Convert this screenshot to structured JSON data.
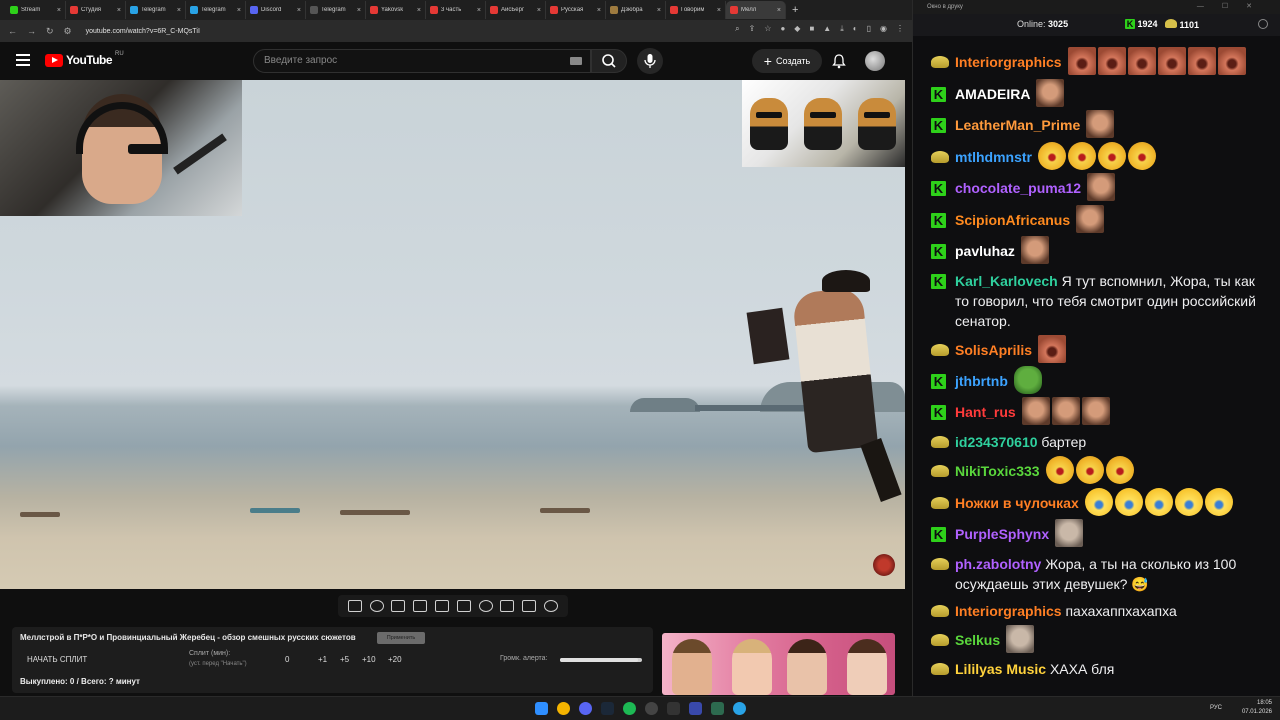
{
  "browser": {
    "tabs": [
      {
        "title": "Stream",
        "color": "#2ed11a"
      },
      {
        "title": "Студия",
        "color": "#e53935"
      },
      {
        "title": "Telegram",
        "color": "#29a3e6"
      },
      {
        "title": "Telegram",
        "color": "#29a3e6"
      },
      {
        "title": "Discord",
        "color": "#5865f2"
      },
      {
        "title": "Telegram",
        "color": "#555555"
      },
      {
        "title": "Yakovsk",
        "color": "#e53935"
      },
      {
        "title": "3 часть",
        "color": "#e53935"
      },
      {
        "title": "АйсБерг",
        "color": "#e53935"
      },
      {
        "title": "Русская",
        "color": "#e53935"
      },
      {
        "title": "Дзюбра",
        "color": "#9e7b3f"
      },
      {
        "title": "Говорим",
        "color": "#e53935"
      },
      {
        "title": "Мелл",
        "color": "#e53935",
        "active": true
      }
    ],
    "url": "youtube.com/watch?v=6R_C-MQsTiI"
  },
  "youtube": {
    "logo_text": "YouTube",
    "region": "RU",
    "search_placeholder": "Введите запрос",
    "create_label": "Создать"
  },
  "panel": {
    "video_title": "Меллстрой в П*Р*О и Провинциальный Жеребец - обзор смешных русских сюжетов",
    "apply_label": "Применить",
    "start_split": "НАЧАТЬ СПЛИТ",
    "split_label": "Сплит (мин):",
    "split_hint": "(уст. перед \"Начать\")",
    "increments": [
      "0",
      "+1",
      "+5",
      "+10",
      "+20"
    ],
    "alert_label": "Громк. алерта:",
    "alert_volume": 0.95,
    "bought": "Выкуплено: 0 / Всего: ? минут"
  },
  "chat": {
    "window_title": "Окно в друку",
    "online_label": "Online:",
    "online_count": "3025",
    "k_count": "1924",
    "gold_count": "1101",
    "messages": [
      {
        "badge": "g",
        "nick": "Interiorgraphics",
        "color": "#ff7f24",
        "emotes": [
          "scream",
          "scream",
          "scream",
          "scream",
          "scream",
          "scream"
        ]
      },
      {
        "badge": "k",
        "nick": "AMADEIRA",
        "color": "#ffffff",
        "emotes": [
          "face"
        ]
      },
      {
        "badge": "k",
        "nick": "LeatherMan_Prime",
        "color": "#ff9a3c",
        "emotes": [
          "face"
        ]
      },
      {
        "badge": "g",
        "nick": "mtlhdmnstr",
        "color": "#3ca3ff",
        "emotes": [
          "laugh",
          "laugh",
          "laugh",
          "laugh"
        ]
      },
      {
        "badge": "k",
        "nick": "chocolate_puma12",
        "color": "#b061ff",
        "emotes": [
          "face"
        ]
      },
      {
        "badge": "k",
        "nick": "ScipionAfricanus",
        "color": "#ff8a1f",
        "emotes": [
          "face"
        ]
      },
      {
        "badge": "k",
        "nick": "pavluhaz",
        "color": "#ffffff",
        "emotes": [
          "face"
        ]
      },
      {
        "badge": "k",
        "nick": "Karl_Karlovech",
        "color": "#2fd09e",
        "text": "Я тут вспомнил, Жора, ты как то говорил, что тебя смотрит один российский сенатор."
      },
      {
        "badge": "g",
        "nick": "SolisAprilis",
        "color": "#ff7f24",
        "emotes": [
          "scream"
        ]
      },
      {
        "badge": "k",
        "nick": "jthbrtnb",
        "color": "#3ca3ff",
        "emotes": [
          "pepe"
        ]
      },
      {
        "badge": "k",
        "nick": "Hant_rus",
        "color": "#ff3b3b",
        "emotes": [
          "face",
          "face",
          "face"
        ]
      },
      {
        "badge": "g",
        "nick": "id234370610",
        "color": "#2fd09e",
        "text": "бартер"
      },
      {
        "badge": "g",
        "nick": "NikiToxic333",
        "color": "#5ad63c",
        "emotes": [
          "laugh",
          "laugh",
          "laugh"
        ]
      },
      {
        "badge": "g",
        "nick": "Ножки в чулочках",
        "color": "#ff7f24",
        "emotes": [
          "lol",
          "lol",
          "lol",
          "lol",
          "lol"
        ]
      },
      {
        "badge": "k",
        "nick": "PurpleSphynx",
        "color": "#b061ff",
        "emotes": [
          "gray"
        ]
      },
      {
        "badge": "g",
        "nick": "ph.zabolotny",
        "color": "#b061ff",
        "text": "Жора, а ты на сколько из 100 осуждаешь этих девушек? 😅"
      },
      {
        "badge": "g",
        "nick": "Interiorgraphics",
        "color": "#ff7f24",
        "text": "пахахаппхахапха"
      },
      {
        "badge": "g",
        "nick": "Selkus",
        "color": "#5ad63c",
        "emotes": [
          "gray"
        ]
      },
      {
        "badge": "g",
        "nick": "Lililyas Music",
        "color": "#ffd23c",
        "text": "ХАХА бля"
      }
    ]
  },
  "taskbar": {
    "lang": "РУС",
    "time": "18:05",
    "date": "07.01.2026"
  }
}
